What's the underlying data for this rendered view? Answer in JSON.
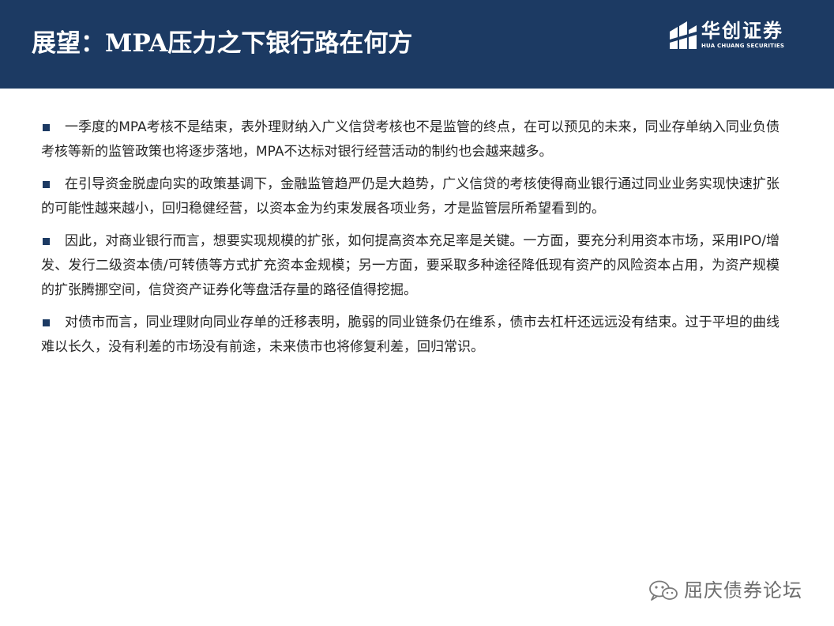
{
  "slide": {
    "title": "展望：MPA压力之下银行路在何方",
    "logo": {
      "name_cn": "华创证券",
      "name_en": "HUA CHUANG SECURITIES"
    },
    "paragraphs": [
      "一季度的MPA考核不是结束，表外理财纳入广义信贷考核也不是监管的终点，在可以预见的未来，同业存单纳入同业负债考核等新的监管政策也将逐步落地，MPA不达标对银行经营活动的制约也会越来越多。",
      "在引导资金脱虚向实的政策基调下，金融监管趋严仍是大趋势，广义信贷的考核使得商业银行通过同业业务实现快速扩张的可能性越来越小，回归稳健经营，以资本金为约束发展各项业务，才是监管层所希望看到的。",
      "因此，对商业银行而言，想要实现规模的扩张，如何提高资本充足率是关键。一方面，要充分利用资本市场，采用IPO/增发、发行二级资本债/可转债等方式扩充资本金规模；另一方面，要采取多种途径降低现有资产的风险资本占用，为资产规模的扩张腾挪空间，信贷资产证券化等盘活存量的路径值得挖掘。",
      "对债市而言，同业理财向同业存单的迁移表明，脆弱的同业链条仍在维系，债市去杠杆还远远没有结束。过于平坦的曲线难以长久，没有利差的市场没有前途，未来债市也将修复利差，回归常识。"
    ],
    "watermark": "屈庆债券论坛"
  },
  "colors": {
    "header_bg": "#1c3a63",
    "bullet": "#1c3a63",
    "body_text": "#262626",
    "watermark_text": "#6e6e6e"
  },
  "icons": {
    "logo_mark": "huachuang-logo-icon",
    "bullet": "square-bullet-icon",
    "watermark": "wechat-icon"
  }
}
